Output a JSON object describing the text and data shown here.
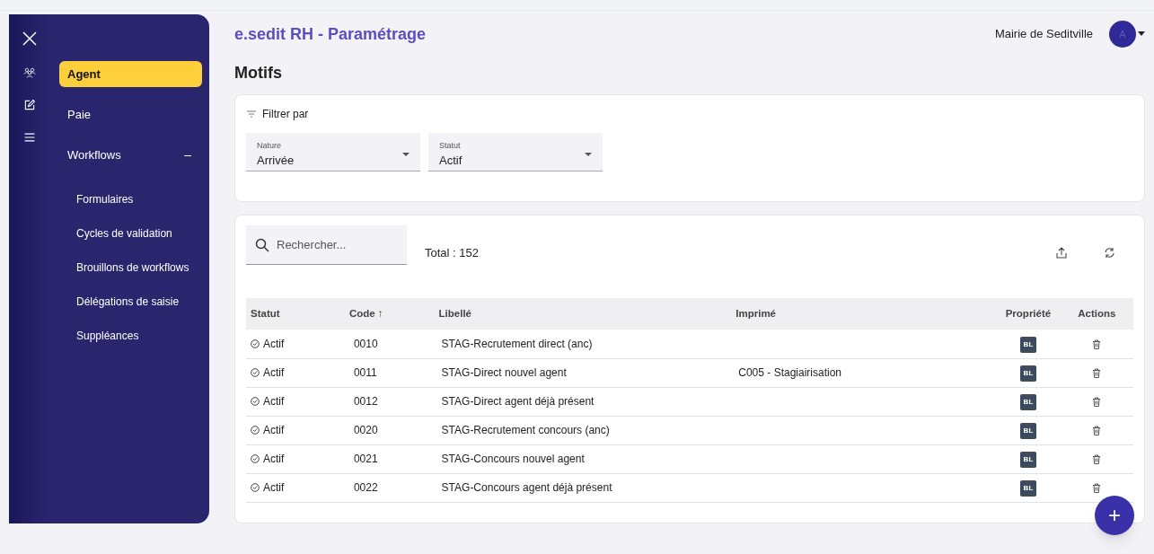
{
  "app_title": "e.sedit RH - Paramétrage",
  "organization": "Mairie de Seditville",
  "avatar": "A",
  "page_title": "Motifs",
  "rail_icons": [
    {
      "kind": "close"
    },
    {
      "kind": "people"
    },
    {
      "kind": "edit"
    },
    {
      "kind": "menu"
    }
  ],
  "sidebar": {
    "items": [
      {
        "label": "Agent",
        "selected": true
      },
      {
        "label": "Paie",
        "selected": false
      },
      {
        "label": "Workflows",
        "selected": false,
        "expanded": true,
        "toggle": "–",
        "children": [
          {
            "label": "Formulaires",
            "selected": false
          },
          {
            "label": "Cycles de validation",
            "selected": false
          },
          {
            "label": "Brouillons de workflows",
            "selected": false
          },
          {
            "label": "Délégations de saisie",
            "selected": false
          },
          {
            "label": "Suppléances",
            "selected": false
          }
        ]
      }
    ]
  },
  "filter": {
    "title": "Filtrer par",
    "fields": [
      {
        "label": "Nature",
        "value": "Arrivée"
      },
      {
        "label": "Statut",
        "value": "Actif"
      }
    ]
  },
  "search": {
    "placeholder": "Rechercher..."
  },
  "total": "Total : 152",
  "table": {
    "columns": [
      "Statut",
      "Code ↑",
      "Libellé",
      "Imprimé",
      "Propriété",
      "Actions"
    ],
    "rows": [
      {
        "status": "Actif",
        "code": "0010",
        "label": "STAG-Recrutement direct (anc)",
        "property": "BL"
      },
      {
        "status": "Actif",
        "code": "0011",
        "label": "STAG-Direct nouvel agent",
        "printed": "C005 - Stagiairisation",
        "property": "BL"
      },
      {
        "status": "Actif",
        "code": "0012",
        "label": "STAG-Direct agent déjà présent",
        "property": "BL"
      },
      {
        "status": "Actif",
        "code": "0020",
        "label": "STAG-Recrutement concours (anc)",
        "property": "BL"
      },
      {
        "status": "Actif",
        "code": "0021",
        "label": "STAG-Concours nouvel agent",
        "property": "BL"
      },
      {
        "status": "Actif",
        "code": "0022",
        "label": "STAG-Concours agent déjà présent",
        "property": "BL"
      }
    ]
  },
  "fab": "+"
}
